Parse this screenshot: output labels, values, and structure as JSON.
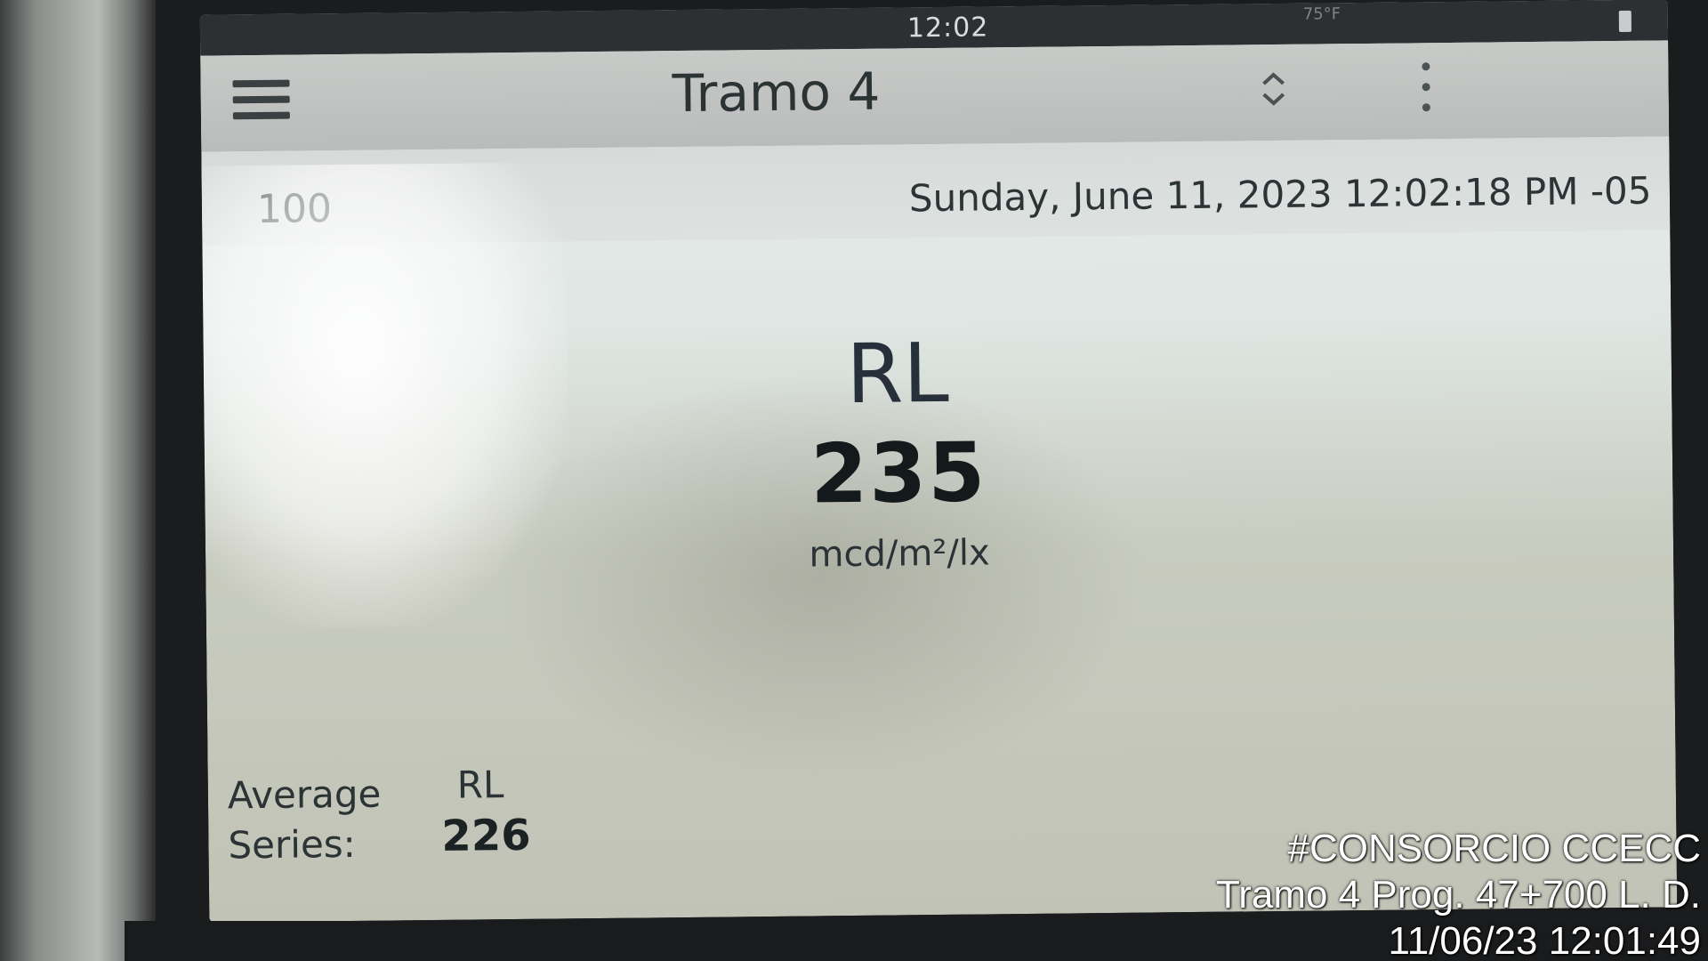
{
  "status_bar": {
    "time": "12:02",
    "temperature": "75°F",
    "icon": "battery-icon"
  },
  "app_bar": {
    "title": "Tramo 4",
    "icons": [
      "menu-icon",
      "up-down-arrows-icon",
      "more-vertical-icon"
    ]
  },
  "info": {
    "id_partial": "100",
    "datetime": "Sunday, June 11, 2023 12:02:18 PM -05"
  },
  "reading": {
    "label": "RL",
    "value": "235",
    "unit": "mcd/m²/lx"
  },
  "average": {
    "label_line1": "Average",
    "label_line2": "Series:",
    "metric": "RL",
    "value": "226"
  },
  "watermark": {
    "line1": "#CONSORCIO CCECC",
    "line2": "Tramo 4 Prog. 47+700 L. D.",
    "line3": "11/06/23  12:01:49"
  }
}
